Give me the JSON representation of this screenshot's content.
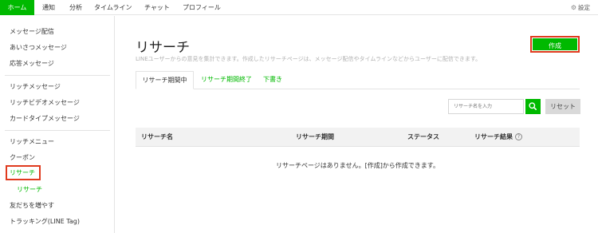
{
  "topnav": {
    "tabs": [
      {
        "label": "ホーム",
        "active": true
      },
      {
        "label": "通知"
      },
      {
        "label": "分析"
      },
      {
        "label": "タイムライン"
      },
      {
        "label": "チャット"
      },
      {
        "label": "プロフィール"
      }
    ],
    "settings_label": "設定",
    "settings_icon": "gear-icon"
  },
  "sidebar": {
    "items": [
      {
        "label": "メッセージ配信"
      },
      {
        "label": "あいさつメッセージ"
      },
      {
        "label": "応答メッセージ"
      },
      {
        "label": "リッチメッセージ"
      },
      {
        "label": "リッチビデオメッセージ"
      },
      {
        "label": "カードタイプメッセージ"
      },
      {
        "label": "リッチメニュー"
      },
      {
        "label": "クーポン"
      },
      {
        "label": "リサーチ",
        "current": true
      },
      {
        "label": "友だちを増やす"
      },
      {
        "label": "トラッキング(LINE Tag)"
      }
    ],
    "sub_item": {
      "label": "リサーチ"
    }
  },
  "main": {
    "title": "リサーチ",
    "description": "LINEユーザーからの意見を集計できます。作成したリサーチページは、メッセージ配信やタイムラインなどからユーザーに配信できます。",
    "create_label": "作成",
    "tabs": [
      {
        "label": "リサーチ期間中",
        "active": true
      },
      {
        "label": "リサーチ期間終了"
      },
      {
        "label": "下書き"
      }
    ],
    "search": {
      "placeholder": "リサーチ名を入力",
      "value": ""
    },
    "reset_label": "リセット",
    "table": {
      "columns": [
        "リサーチ名",
        "リサーチ期間",
        "ステータス",
        "リサーチ結果"
      ],
      "help_icon_glyph": "?",
      "empty_message": "リサーチページはありません。[作成]から作成できます。"
    }
  },
  "colors": {
    "accent": "#00b900",
    "highlight": "#e03a1e"
  }
}
